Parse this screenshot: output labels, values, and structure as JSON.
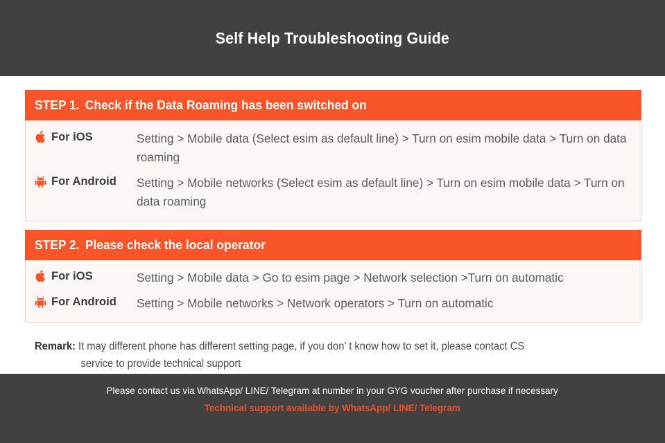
{
  "header": {
    "title": "Self Help Troubleshooting Guide",
    "background_color": "#414141",
    "text_color": "#FFFFFF"
  },
  "theme": {
    "accent_color": "#F9552B",
    "panel_background": "#FDF8F6",
    "panel_border": "#F6D4CE",
    "body_text_color": "#5B5B5B",
    "label_text_color": "#3A3A3A",
    "footer_accent_color": "#F2502B"
  },
  "steps": [
    {
      "step_label": "STEP 1.",
      "step_title": "Check if the Data Roaming has been switched on",
      "rows": [
        {
          "icon": "apple-logo-icon",
          "platform": "For iOS",
          "instructions": "Setting > Mobile data (Select esim as default line) > Turn on esim mobile data > Turn on data roaming"
        },
        {
          "icon": "android-robot-icon",
          "platform": "For Android",
          "instructions": "Setting > Mobile networks (Select esim as default line) > Turn on esim mobile data > Turn on data roaming"
        }
      ]
    },
    {
      "step_label": "STEP 2.",
      "step_title": "Please check the local operator",
      "rows": [
        {
          "icon": "apple-logo-icon",
          "platform": "For iOS",
          "instructions": "Setting > Mobile data > Go to esim page > Network selection >Turn on automatic"
        },
        {
          "icon": "android-robot-icon",
          "platform": "For Android",
          "instructions": "Setting > Mobile networks > Network operators > Turn on automatic"
        }
      ]
    }
  ],
  "remark": {
    "label": "Remark:",
    "line_1": "It may different phone has different setting page, if you don’ t know how to set it,  please contact CS",
    "line_2": "service to provide technical support"
  },
  "footer": {
    "line_1": "Please contact us via WhatsApp/ LINE/ Telegram at number in your GYG voucher after purchase if necessary",
    "line_2": "Technical support available by WhatsApp/ LINE/ Telegram"
  }
}
